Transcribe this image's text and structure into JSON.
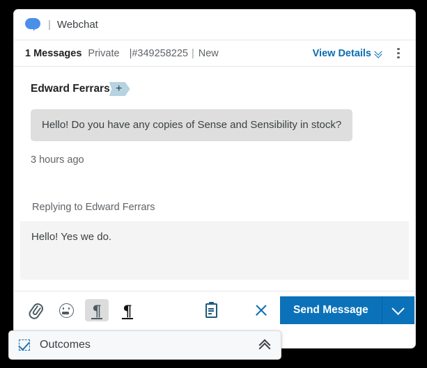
{
  "channel_bar": {
    "icon": "chat-bubble-icon",
    "separator": "|",
    "name": "Webchat"
  },
  "meta_bar": {
    "message_count": "1 Messages",
    "privacy": "Private",
    "case_id": "|#349258225",
    "separator": "|",
    "status": "New",
    "view_details_label": "View Details",
    "view_details_icon": "double-chevron-down-icon",
    "kebab_icon": "more-options-icon"
  },
  "conversation": {
    "sender_name": "Edward Ferrars",
    "sender_badge_symbol": "+",
    "message_text": "Hello! Do you have any copies of Sense and Sensibility in stock?",
    "timestamp": "3 hours ago"
  },
  "composer": {
    "replying_to_label": "Replying to Edward Ferrars",
    "reply_text": "Hello! Yes we do."
  },
  "toolbar": {
    "items": [
      {
        "name": "attach-icon",
        "label": "Attach"
      },
      {
        "name": "emoji-icon",
        "label": "Emoji"
      },
      {
        "name": "paragraph-icon",
        "label": "Paragraph"
      },
      {
        "name": "paragraph-bold-icon",
        "label": "Paragraph Bold"
      },
      {
        "name": "notes-icon",
        "label": "Notes"
      },
      {
        "name": "close-icon",
        "label": "Close"
      }
    ],
    "send_label": "Send Message",
    "send_caret_icon": "chevron-down-icon"
  },
  "outcomes": {
    "icon": "checkbox-check-icon",
    "title": "Outcomes",
    "expand_icon": "double-chevron-up-icon"
  },
  "colors": {
    "accent_blue": "#0b72ba",
    "link_blue": "#0b6cb1",
    "bubble_gray": "#dedede",
    "reply_bg": "#f4f4f4",
    "badge_blue": "#b5d3e0"
  }
}
